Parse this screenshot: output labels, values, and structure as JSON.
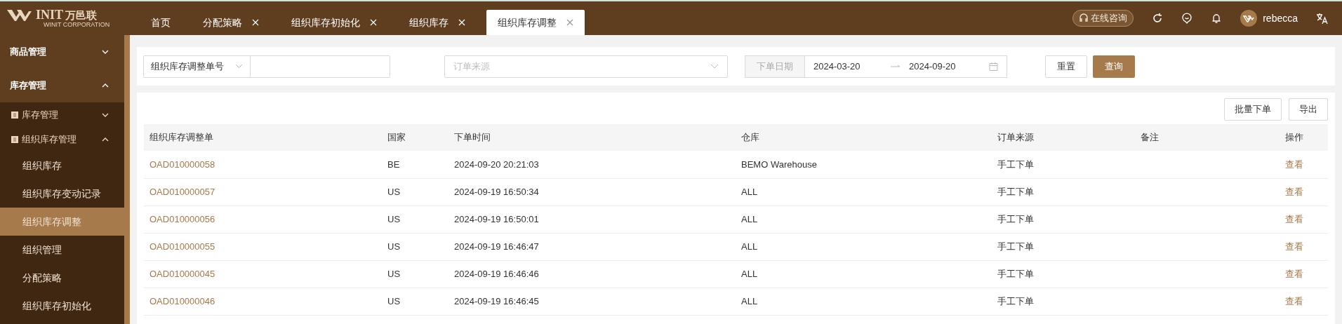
{
  "logo": {
    "wordmark": "INIT",
    "name": "万邑联",
    "subtitle": "WINIT CORPORATION"
  },
  "tabs": [
    {
      "label": "首页",
      "closable": false,
      "selected": false
    },
    {
      "label": "分配策略",
      "closable": true,
      "selected": false
    },
    {
      "label": "组织库存初始化",
      "closable": true,
      "selected": false
    },
    {
      "label": "组织库存",
      "closable": true,
      "selected": false
    },
    {
      "label": "组织库存调整",
      "closable": true,
      "selected": true
    }
  ],
  "header": {
    "consult": "在线咨询",
    "user": "rebecca"
  },
  "sidebar": {
    "items": [
      {
        "label": "商品管理",
        "expanded": false
      },
      {
        "label": "库存管理",
        "expanded": true,
        "children": [
          {
            "label": "库存管理",
            "expanded": false
          },
          {
            "label": "组织库存管理",
            "expanded": true,
            "children": [
              {
                "label": "组织库存",
                "selected": false
              },
              {
                "label": "组织库存变动记录",
                "selected": false
              },
              {
                "label": "组织库存调整",
                "selected": true
              },
              {
                "label": "组织管理",
                "selected": false
              },
              {
                "label": "分配策略",
                "selected": false
              },
              {
                "label": "组织库存初始化",
                "selected": false
              }
            ]
          }
        ]
      }
    ]
  },
  "filters": {
    "field_select": "组织库存调整单号",
    "source": {
      "placeholder": "订单来源"
    },
    "date_label": "下单日期",
    "date_start": "2024-03-20",
    "date_end": "2024-09-20",
    "reset": "重置",
    "query": "查询"
  },
  "actions": [
    "批量下单",
    "导出"
  ],
  "table": {
    "columns": [
      "组织库存调整单",
      "国家",
      "下单时间",
      "仓库",
      "订单来源",
      "备注",
      "操作"
    ],
    "rows": [
      {
        "id": "OAD010000058",
        "country": "BE",
        "time": "2024-09-20 20:21:03",
        "warehouse": "BEMO Warehouse",
        "source": "手工下单",
        "action": "查看"
      },
      {
        "id": "OAD010000057",
        "country": "US",
        "time": "2024-09-19 16:50:34",
        "warehouse": "ALL",
        "source": "手工下单",
        "action": "查看"
      },
      {
        "id": "OAD010000056",
        "country": "US",
        "time": "2024-09-19 16:50:01",
        "warehouse": "ALL",
        "source": "手工下单",
        "action": "查看"
      },
      {
        "id": "OAD010000055",
        "country": "US",
        "time": "2024-09-19 16:46:47",
        "warehouse": "ALL",
        "source": "手工下单",
        "action": "查看"
      },
      {
        "id": "OAD010000045",
        "country": "US",
        "time": "2024-09-19 16:46:46",
        "warehouse": "ALL",
        "source": "手工下单",
        "action": "查看"
      },
      {
        "id": "OAD010000046",
        "country": "US",
        "time": "2024-09-19 16:46:45",
        "warehouse": "ALL",
        "source": "手工下单",
        "action": "查看"
      }
    ]
  }
}
